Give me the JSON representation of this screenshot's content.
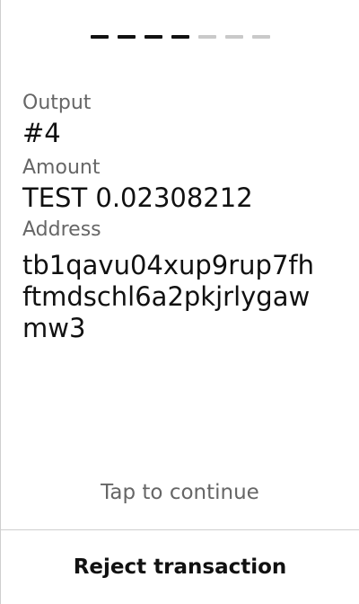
{
  "progress": {
    "total_steps": 7,
    "current_step": 4
  },
  "output": {
    "label": "Output",
    "value": "#4"
  },
  "amount": {
    "label": "Amount",
    "value": "TEST 0.02308212"
  },
  "address": {
    "label": "Address",
    "lines": [
      "tb1qavu04xup9rup7fh",
      "ftmdschl6a2pkjrlygaw",
      "mw3"
    ]
  },
  "footer": {
    "tap_hint": "Tap to continue",
    "reject_label": "Reject transaction"
  },
  "colors": {
    "text_primary": "#111111",
    "text_secondary": "#666666",
    "progress_active": "#111111",
    "progress_inactive": "#c9c9c9",
    "divider": "#cfcfcf"
  }
}
